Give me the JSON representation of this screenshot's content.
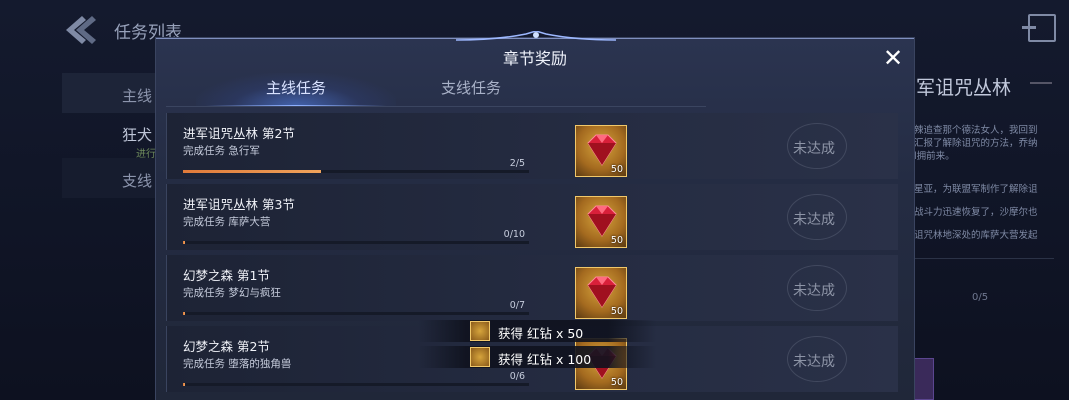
{
  "background": {
    "title": "任务列表",
    "tabs": [
      "主线",
      "支线"
    ],
    "selected_quest": "狂犬",
    "selected_quest_sub": "进行",
    "detail_title": "军诅咒丛林",
    "detail_lines_1": [
      "辣追查那个德法女人，我回到",
      "汇报了解除诅咒的方法，乔纳",
      "l拥前来。"
    ],
    "detail_lines_2": [
      "星亚，为联盟军制作了解除诅",
      "战斗力迅速恢复了，沙摩尔也",
      "诅咒林地深处的库萨大营发起"
    ],
    "detail_count": "0/5"
  },
  "dialog": {
    "title": "章节奖励",
    "close_glyph": "✕",
    "tabs": {
      "main": "主线任务",
      "side": "支线任务"
    },
    "rows": [
      {
        "title": "进军诅咒丛林 第2节",
        "sub": "完成任务 急行军",
        "count": "2/5",
        "progress": 0.4,
        "reward_qty": "50",
        "status": "未达成"
      },
      {
        "title": "进军诅咒丛林 第3节",
        "sub": "完成任务 库萨大营",
        "count": "0/10",
        "progress": 0.0,
        "reward_qty": "50",
        "status": "未达成"
      },
      {
        "title": "幻梦之森 第1节",
        "sub": "完成任务 梦幻与疯狂",
        "count": "0/7",
        "progress": 0.0,
        "reward_qty": "50",
        "status": "未达成"
      },
      {
        "title": "幻梦之森 第2节",
        "sub": "完成任务 堕落的独角兽",
        "count": "0/6",
        "progress": 0.0,
        "reward_qty": "50",
        "status": "未达成"
      }
    ]
  },
  "toasts": [
    {
      "text": "获得 红钻 x 50"
    },
    {
      "text": "获得 红钻 x 100"
    }
  ],
  "colors": {
    "progress": "#f0a35b",
    "gem": "#d9203a",
    "frame": "#f1c86a"
  },
  "icons": {
    "back": "back-arrow-icon",
    "exit": "exit-icon",
    "gem": "red-diamond-icon",
    "close": "close-icon"
  }
}
